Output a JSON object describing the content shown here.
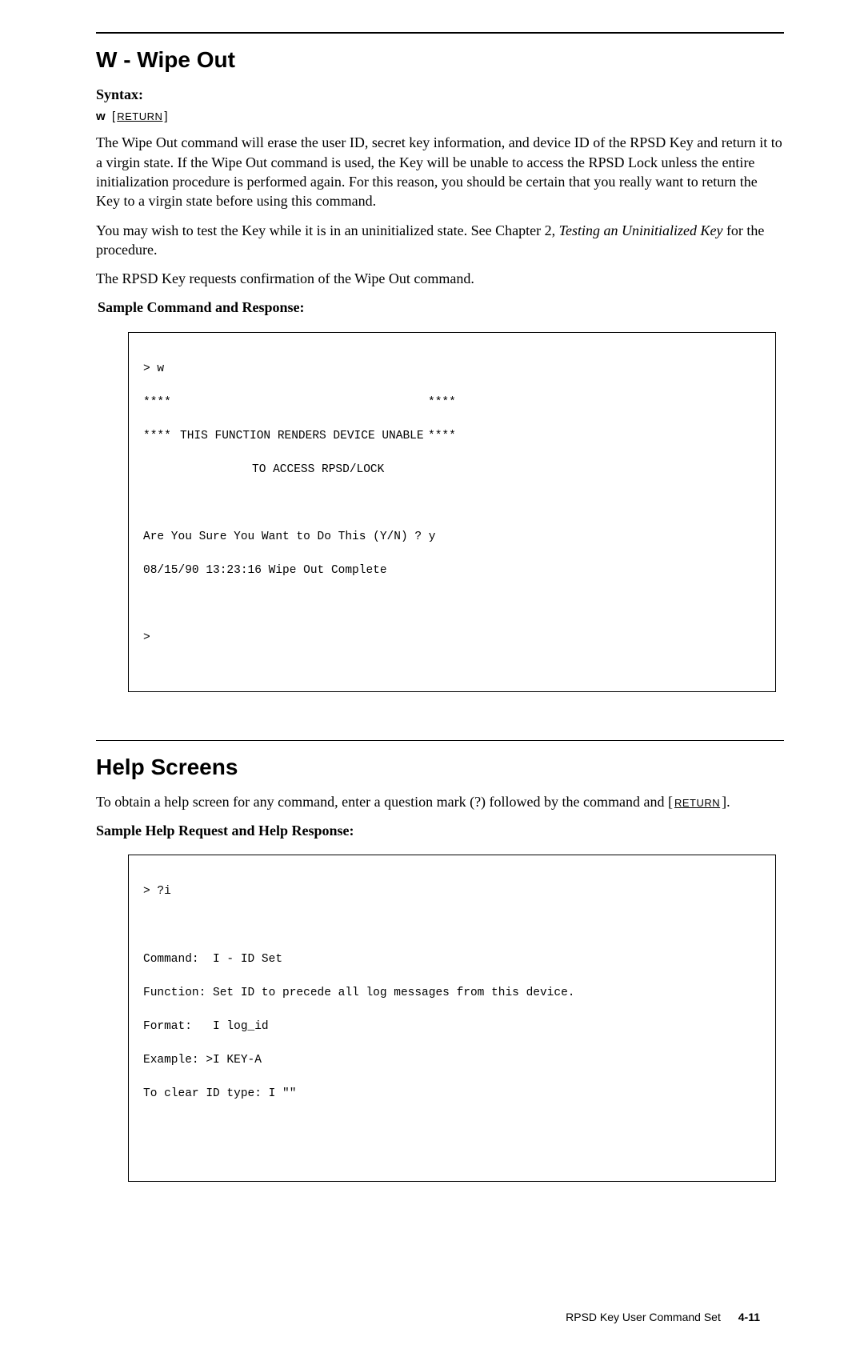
{
  "section1": {
    "title": "W - Wipe Out",
    "syntax_label": "Syntax:",
    "syntax_cmd": "w",
    "syntax_bracket_open": "[",
    "syntax_key": "RETURN",
    "syntax_bracket_close": "]",
    "p1": "The Wipe Out command will erase the user ID, secret key information, and device ID of the RPSD Key and return it to a virgin state. If the Wipe Out command is used, the Key will be unable to access the RPSD Lock unless the entire initialization procedure is performed again. For this reason, you should be certain that you really want to return the Key to a virgin state before using this command.",
    "p2_a": "You may wish to test the Key while it is in an uninitialized state. See Chapter 2, ",
    "p2_i": "Testing an Uninitialized Key",
    "p2_b": " for the procedure.",
    "p3": "The RPSD Key requests confirmation of the Wipe Out command.",
    "sample_label": "Sample Command and Response:",
    "term": {
      "l1": "> w",
      "stars": "****",
      "msg1": "THIS FUNCTION RENDERS DEVICE UNABLE",
      "msg2": "TO ACCESS RPSD/LOCK",
      "l6": "Are You Sure You Want to Do This (Y/N) ? y",
      "l7": "08/15/90 13:23:16 Wipe Out Complete",
      "l9": ">"
    }
  },
  "section2": {
    "title": "Help Screens",
    "intro_a": "To obtain a help screen for any command, enter a question mark (?) followed by the command and ",
    "intro_b_open": "[",
    "intro_key": "RETURN",
    "intro_b_close": "].",
    "sample_label": "Sample Help Request and Help Response:",
    "term": {
      "l1": "> ?i",
      "l3": "Command:  I - ID Set",
      "l4": "Function: Set ID to precede all log messages from this device.",
      "l5": "Format:   I log_id",
      "l6": "Example: >I KEY-A",
      "l7": "To clear ID type: I \"\""
    }
  },
  "footer": {
    "text": "RPSD Key User Command Set",
    "page": "4-11"
  }
}
